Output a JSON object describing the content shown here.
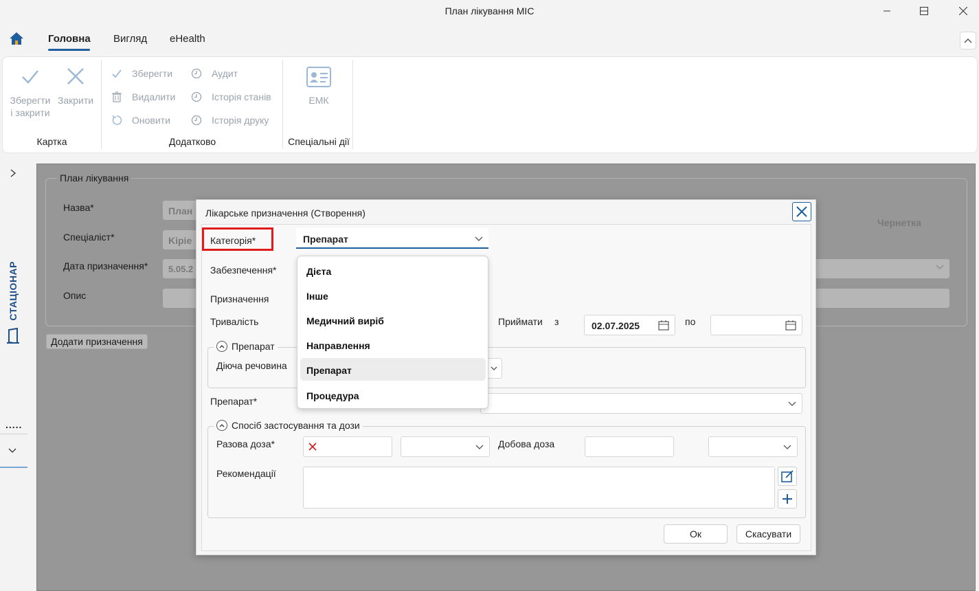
{
  "window": {
    "title": "План лікування МІС"
  },
  "ribbon": {
    "tabs": [
      {
        "label": "Головна"
      },
      {
        "label": "Вигляд"
      },
      {
        "label": "eHealth"
      }
    ],
    "groups": {
      "card": {
        "label": "Картка",
        "save_close_line1": "Зберегти",
        "save_close_line2": "і закрити",
        "close": "Закрити"
      },
      "extra": {
        "label": "Додатково",
        "save": "Зберегти",
        "delete": "Видалити",
        "refresh": "Оновити",
        "audit": "Аудит",
        "state_history": "Історія станів",
        "print_history": "Історія друку"
      },
      "special": {
        "label": "Спеціальні дії",
        "emk": "ЕМК"
      }
    }
  },
  "left_rail": {
    "department": "СТАЦІОНАР",
    "dots": "....."
  },
  "plan": {
    "legend": "План лікування",
    "name_label": "Назва*",
    "name_value": "План",
    "specialist_label": "Спеціаліст*",
    "specialist_value": "Kipie",
    "date_label": "Дата призначення*",
    "date_value": "5.05.2",
    "description_label": "Опис",
    "status": "Чернетка",
    "add_button": "Додати призначення"
  },
  "dialog": {
    "title": "Лікарське призначення (Створення)",
    "category_label": "Категорія*",
    "category_value": "Препарат",
    "provision_label": "Забезпечення*",
    "assignment_label": "Призначення",
    "duration_label": "Тривалість",
    "take_label": "Приймати",
    "from_label": "з",
    "from_date": "02.07.2025",
    "to_label": "по",
    "drug_section": "Препарат",
    "active_substance_label": "Діюча речовина",
    "drug_label": "Препарат*",
    "dose_section": "Спосіб застосування та дози",
    "single_dose_label": "Разова доза*",
    "daily_dose_label": "Добова доза",
    "recommendations_label": "Рекомендації",
    "ok": "Ок",
    "cancel": "Скасувати"
  },
  "dropdown": {
    "options": [
      "Дієта",
      "Інше",
      "Медичний виріб",
      "Направлення",
      "Препарат",
      "Процедура"
    ],
    "selected": "Препарат"
  },
  "colors": {
    "accent": "#1f5e9e",
    "highlight": "#e01b1b",
    "disabled_icon": "#9aa3ad",
    "overlay": "#979797"
  }
}
